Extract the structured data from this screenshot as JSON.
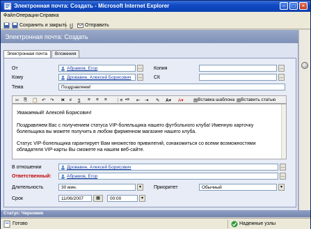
{
  "window": {
    "title": "Электронная почта: Создать - Microsoft Internet Explorer"
  },
  "menu": {
    "items": [
      "Файл",
      "Операции",
      "Справка"
    ]
  },
  "toolbar": {
    "save_close": "Сохранить и закрыть",
    "send": "Отправить"
  },
  "header": {
    "title": "Электронная почта: Создать"
  },
  "tabs": [
    "Электронная почта",
    "Вложения"
  ],
  "form": {
    "from_label": "От",
    "from_value": "Абрамов, Егор",
    "to_label": "Кому",
    "to_value": "Дровавин, Алексей Борисович",
    "cc_label": "Копия",
    "bcc_label": "СК",
    "subject_label": "Тема",
    "subject_value": "Поздравляем!",
    "regarding_label": "В отношении",
    "regarding_value": "Дровавин, Алексей Борисович",
    "owner_label": "Ответственный:",
    "owner_value": "Абрамов, Егор",
    "duration_label": "Длительность",
    "duration_value": "30 мин.",
    "priority_label": "Приоритет",
    "priority_value": "Обычный",
    "due_label": "Срок",
    "due_date": "11/06/2007",
    "due_time": "00:00"
  },
  "format_toolbar": {
    "insert_template": "Вставка шаблона",
    "insert_article": "Вставить статью"
  },
  "body": {
    "line1": "Уважаемый! Алексей Борисович!",
    "line2": "Поздравляем Вас с получением статуса VIP-болельщика нашего футбольного клуба! Именную карточку",
    "line3": "болельщика вы можете получить в любом фирменном магазине нашего клуба.",
    "line4": "Статус VIP-болельщика гарантирует Вам множество привилегий, ознакомиться со всеми возможностями",
    "line5": "обладателя VIP-карты Вы сможете на нашем веб-сайте."
  },
  "status": {
    "label": "Статус: Черновик"
  },
  "ie_status": {
    "ready": "Готово",
    "zone": "Надежные узлы"
  },
  "colors": {
    "title_blue": "#0f4ac4",
    "header": "#8a9bc1",
    "link": "#1a3ea8",
    "required_red": "#c00000"
  }
}
